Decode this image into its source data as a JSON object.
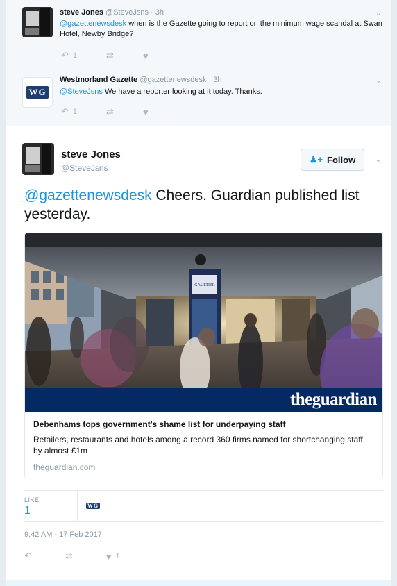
{
  "replies": [
    {
      "name": "steve Jones",
      "handle": "@SteveJsns",
      "time": "3h",
      "mention": "@gazettenewsdesk",
      "text": " when is the Gazette going to report on the minimum wage scandal at Swan Hotel, Newby Bridge?",
      "reply_count": "1",
      "avatar_icon": "steve-jones-avatar"
    },
    {
      "name": "Westmorland Gazette",
      "handle": "@gazettenewsdesk",
      "time": "3h",
      "mention": "@SteveJsns",
      "text": " We have a reporter looking at it today. Thanks.",
      "reply_count": "1",
      "logo_text": "WG",
      "avatar_icon": "westmorland-gazette-logo"
    }
  ],
  "main_tweet": {
    "name": "steve Jones",
    "handle": "@SteveJsns",
    "follow_label": "Follow",
    "mention": "@gazettenewsdesk",
    "text": " Cheers.  Guardian published list yesterday.",
    "card": {
      "brand": "theguardian",
      "title": "Debenhams tops government's shame list for underpaying staff",
      "description": "Retailers, restaurants and hotels among a record 360 firms named for shortchanging staff by almost £1m",
      "domain": "theguardian.com",
      "storefront_sign": "GAULTIER"
    },
    "like_label": "LIKE",
    "like_count": "1",
    "liker_logo": "WG",
    "timestamp": "9:42 AM - 17 Feb 2017",
    "heart_count": "1"
  },
  "colors": {
    "accent": "#1b95e0",
    "guardian_blue": "#052962",
    "muted": "#8899a6",
    "background": "#e6ecf0"
  },
  "icons": {
    "reply": "reply-icon",
    "retweet": "retweet-icon",
    "like": "heart-icon",
    "more": "chevron-down-icon",
    "follow": "add-user-icon"
  }
}
